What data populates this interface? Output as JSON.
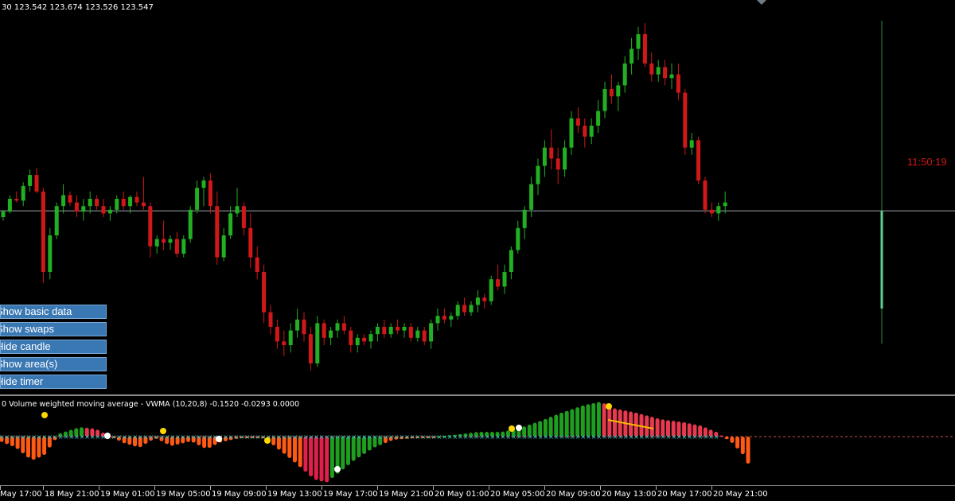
{
  "ohlc_readout": "30 123.542 123.674 123.526 123.547",
  "timer_text": "11:50:19",
  "buttons": [
    {
      "label": "Show basic data"
    },
    {
      "label": "Show swaps"
    },
    {
      "label": "Hide candle"
    },
    {
      "label": "Show area(s)"
    },
    {
      "label": "Hide timer"
    }
  ],
  "indicator_label": "0 Volume weighted moving average - VWMA (10,20,8) -0.1520 -0.0293 0.0000",
  "x_axis_labels": [
    "May 17:00",
    "18 May 21:00",
    "19 May 01:00",
    "19 May 05:00",
    "19 May 09:00",
    "19 May 13:00",
    "19 May 17:00",
    "19 May 21:00",
    "20 May 01:00",
    "20 May 05:00",
    "20 May 09:00",
    "20 May 13:00",
    "20 May 17:00",
    "20 May 21:00"
  ],
  "colors": {
    "bull_candle": "#22b022",
    "bear_candle": "#d01818",
    "price_line": "#9aa3a8",
    "timer": "#d01818",
    "button_bg": "#3a78b4",
    "histo_up_strong": "#1f9e1f",
    "histo_up_weak": "#39e047",
    "histo_down_strong": "#ff5a14",
    "histo_down_weak": "#e0204a",
    "signal_line": "#30d0d0",
    "dot_white": "#ffffff",
    "dot_yellow": "#ffd800"
  },
  "chart_data": {
    "type": "candlestick",
    "current_price": 123.547,
    "candles": [
      [
        123.53,
        123.55,
        123.52,
        123.545
      ],
      [
        123.545,
        123.59,
        123.54,
        123.58
      ],
      [
        123.58,
        123.6,
        123.57,
        123.575
      ],
      [
        123.575,
        123.625,
        123.56,
        123.615
      ],
      [
        123.615,
        123.66,
        123.6,
        123.645
      ],
      [
        123.645,
        123.665,
        123.595,
        123.6
      ],
      [
        123.6,
        123.61,
        123.35,
        123.38
      ],
      [
        123.38,
        123.5,
        123.36,
        123.48
      ],
      [
        123.48,
        123.57,
        123.47,
        123.56
      ],
      [
        123.56,
        123.62,
        123.54,
        123.59
      ],
      [
        123.59,
        123.6,
        123.56,
        123.57
      ],
      [
        123.57,
        123.59,
        123.53,
        123.545
      ],
      [
        123.545,
        123.58,
        123.52,
        123.56
      ],
      [
        123.56,
        123.6,
        123.54,
        123.58
      ],
      [
        123.58,
        123.59,
        123.55,
        123.56
      ],
      [
        123.56,
        123.58,
        123.53,
        123.54
      ],
      [
        123.54,
        123.56,
        123.52,
        123.55
      ],
      [
        123.55,
        123.59,
        123.54,
        123.58
      ],
      [
        123.58,
        123.6,
        123.55,
        123.56
      ],
      [
        123.56,
        123.59,
        123.54,
        123.585
      ],
      [
        123.585,
        123.6,
        123.56,
        123.57
      ],
      [
        123.57,
        123.64,
        123.55,
        123.56
      ],
      [
        123.56,
        123.57,
        123.42,
        123.45
      ],
      [
        123.45,
        123.48,
        123.43,
        123.47
      ],
      [
        123.47,
        123.52,
        123.44,
        123.46
      ],
      [
        123.46,
        123.48,
        123.44,
        123.47
      ],
      [
        123.47,
        123.49,
        123.42,
        123.43
      ],
      [
        123.43,
        123.48,
        123.42,
        123.47
      ],
      [
        123.47,
        123.56,
        123.46,
        123.55
      ],
      [
        123.55,
        123.63,
        123.54,
        123.61
      ],
      [
        123.61,
        123.64,
        123.56,
        123.63
      ],
      [
        123.63,
        123.65,
        123.54,
        123.56
      ],
      [
        123.56,
        123.6,
        123.4,
        123.42
      ],
      [
        123.42,
        123.5,
        123.41,
        123.48
      ],
      [
        123.48,
        123.56,
        123.47,
        123.54
      ],
      [
        123.54,
        123.61,
        123.53,
        123.56
      ],
      [
        123.56,
        123.57,
        123.48,
        123.5
      ],
      [
        123.5,
        123.54,
        123.39,
        123.42
      ],
      [
        123.42,
        123.45,
        123.36,
        123.38
      ],
      [
        123.38,
        123.4,
        123.24,
        123.27
      ],
      [
        123.27,
        123.29,
        123.21,
        123.23
      ],
      [
        123.23,
        123.25,
        123.17,
        123.19
      ],
      [
        123.19,
        123.22,
        123.15,
        123.18
      ],
      [
        123.18,
        123.24,
        123.16,
        123.22
      ],
      [
        123.22,
        123.28,
        123.2,
        123.25
      ],
      [
        123.25,
        123.27,
        123.19,
        123.21
      ],
      [
        123.21,
        123.23,
        123.11,
        123.13
      ],
      [
        123.13,
        123.26,
        123.12,
        123.24
      ],
      [
        123.24,
        123.25,
        123.18,
        123.2
      ],
      [
        123.2,
        123.23,
        123.18,
        123.22
      ],
      [
        123.22,
        123.25,
        123.2,
        123.24
      ],
      [
        123.24,
        123.26,
        123.21,
        123.22
      ],
      [
        123.22,
        123.23,
        123.16,
        123.18
      ],
      [
        123.18,
        123.21,
        123.16,
        123.2
      ],
      [
        123.2,
        123.21,
        123.18,
        123.19
      ],
      [
        123.19,
        123.22,
        123.17,
        123.21
      ],
      [
        123.21,
        123.24,
        123.19,
        123.23
      ],
      [
        123.23,
        123.25,
        123.2,
        123.21
      ],
      [
        123.21,
        123.24,
        123.2,
        123.23
      ],
      [
        123.23,
        123.25,
        123.21,
        123.22
      ],
      [
        123.22,
        123.24,
        123.2,
        123.23
      ],
      [
        123.23,
        123.24,
        123.19,
        123.2
      ],
      [
        123.2,
        123.23,
        123.19,
        123.22
      ],
      [
        123.22,
        123.23,
        123.18,
        123.19
      ],
      [
        123.19,
        123.25,
        123.17,
        123.24
      ],
      [
        123.24,
        123.28,
        123.22,
        123.26
      ],
      [
        123.26,
        123.28,
        123.24,
        123.25
      ],
      [
        123.25,
        123.27,
        123.23,
        123.26
      ],
      [
        123.26,
        123.3,
        123.25,
        123.29
      ],
      [
        123.29,
        123.31,
        123.26,
        123.27
      ],
      [
        123.27,
        123.3,
        123.26,
        123.29
      ],
      [
        123.29,
        123.33,
        123.27,
        123.31
      ],
      [
        123.31,
        123.32,
        123.28,
        123.3
      ],
      [
        123.3,
        123.37,
        123.29,
        123.36
      ],
      [
        123.36,
        123.4,
        123.33,
        123.34
      ],
      [
        123.34,
        123.4,
        123.32,
        123.38
      ],
      [
        123.38,
        123.45,
        123.36,
        123.44
      ],
      [
        123.44,
        123.52,
        123.43,
        123.5
      ],
      [
        123.5,
        123.56,
        123.47,
        123.55
      ],
      [
        123.55,
        123.64,
        123.53,
        123.62
      ],
      [
        123.62,
        123.69,
        123.59,
        123.67
      ],
      [
        123.67,
        123.74,
        123.64,
        123.72
      ],
      [
        123.72,
        123.77,
        123.66,
        123.69
      ],
      [
        123.69,
        123.72,
        123.62,
        123.66
      ],
      [
        123.66,
        123.74,
        123.64,
        123.72
      ],
      [
        123.72,
        123.82,
        123.7,
        123.8
      ],
      [
        123.8,
        123.83,
        123.76,
        123.78
      ],
      [
        123.78,
        123.8,
        123.72,
        123.75
      ],
      [
        123.75,
        123.8,
        123.73,
        123.78
      ],
      [
        123.78,
        123.85,
        123.76,
        123.82
      ],
      [
        123.82,
        123.9,
        123.8,
        123.88
      ],
      [
        123.88,
        123.92,
        123.84,
        123.86
      ],
      [
        123.86,
        123.9,
        123.82,
        123.89
      ],
      [
        123.89,
        123.97,
        123.87,
        123.95
      ],
      [
        123.95,
        124.02,
        123.92,
        123.99
      ],
      [
        123.99,
        124.05,
        123.96,
        124.03
      ],
      [
        124.03,
        124.06,
        123.94,
        123.95
      ],
      [
        123.95,
        123.98,
        123.9,
        123.92
      ],
      [
        123.92,
        123.96,
        123.9,
        123.94
      ],
      [
        123.94,
        123.96,
        123.89,
        123.91
      ],
      [
        123.91,
        123.95,
        123.88,
        123.92
      ],
      [
        123.92,
        123.95,
        123.85,
        123.87
      ],
      [
        123.87,
        123.88,
        123.7,
        123.72
      ],
      [
        123.72,
        123.76,
        123.7,
        123.74
      ],
      [
        123.74,
        123.75,
        123.62,
        123.63
      ],
      [
        123.63,
        123.64,
        123.54,
        123.55
      ],
      [
        123.55,
        123.57,
        123.53,
        123.54
      ],
      [
        123.54,
        123.57,
        123.52,
        123.56
      ],
      [
        123.56,
        123.6,
        123.54,
        123.57
      ]
    ]
  }
}
